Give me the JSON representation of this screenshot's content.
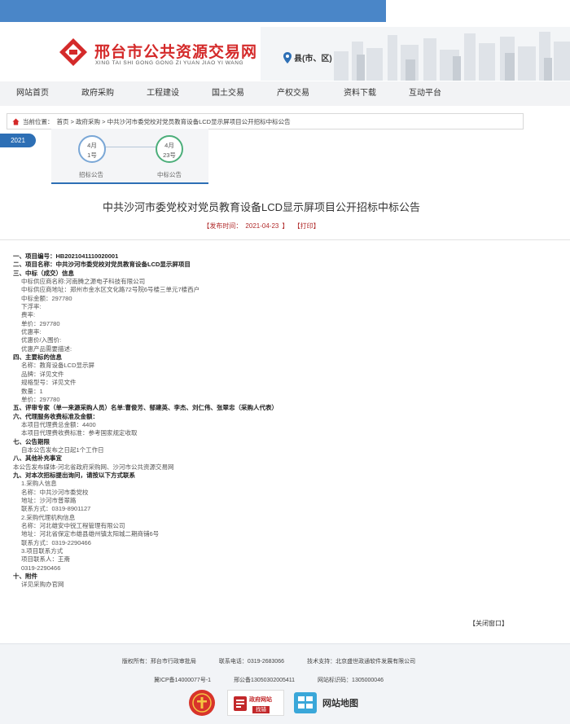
{
  "site": {
    "title": "邢台市公共资源交易网",
    "pinyin": "XING TAI SHI GONG GONG ZI YUAN JIAO YI WANG",
    "region": "县(市、区)"
  },
  "nav": [
    {
      "label": "网站首页"
    },
    {
      "label": "政府采购"
    },
    {
      "label": "工程建设"
    },
    {
      "label": "国土交易"
    },
    {
      "label": "产权交易"
    },
    {
      "label": "资料下载"
    },
    {
      "label": "互动平台"
    }
  ],
  "breadcrumb": {
    "prefix": "当前位置：",
    "path": "首页 > 政府采购 > 中共沙河市委党校对党员教育设备LCD显示屏项目公开招标中标公告"
  },
  "timeline": {
    "year": "2021",
    "nodes": [
      {
        "month": "4月",
        "day": "1号",
        "label": "招标公告"
      },
      {
        "month": "4月",
        "day": "23号",
        "label": "中标公告"
      }
    ]
  },
  "article": {
    "title": "中共沙河市委党校对党员教育设备LCD显示屏项目公开招标中标公告",
    "publish_label": "【发布时间：",
    "publish_date": "2021-04-23",
    "publish_close": "】",
    "print": "【打印】",
    "lines": [
      {
        "t": "h",
        "text": "一、项目编号：HB2021041110020001"
      },
      {
        "t": "h",
        "text": "二、项目名称：中共沙河市委党校对党员教育设备LCD显示屏项目"
      },
      {
        "t": "h",
        "text": "三、中标（成交）信息"
      },
      {
        "t": "s",
        "text": "中标供应商名称:河南腾之源电子科技有限公司"
      },
      {
        "t": "s",
        "text": "中标供应商地址：郑州市金水区文化路72号院6号楼三单元7楼西户"
      },
      {
        "t": "s",
        "text": "中标金额：297780"
      },
      {
        "t": "s",
        "text": "下浮率:"
      },
      {
        "t": "s",
        "text": "费率:"
      },
      {
        "t": "s",
        "text": "单价：297780"
      },
      {
        "t": "s",
        "text": "优惠率:"
      },
      {
        "t": "s",
        "text": "优惠价/入围价:"
      },
      {
        "t": "s",
        "text": "优惠产品需要描述:"
      },
      {
        "t": "h",
        "text": "四、主要标的信息"
      },
      {
        "t": "s",
        "text": "名称：教育设备LCD显示屏"
      },
      {
        "t": "s",
        "text": "品牌：详见文件"
      },
      {
        "t": "s",
        "text": "规格型号：详见文件"
      },
      {
        "t": "s",
        "text": "数量：1"
      },
      {
        "t": "s",
        "text": "单价：297780"
      },
      {
        "t": "h",
        "text": "五、评审专家（单一来源采购人员）名单:曹俊芳、郁建英、李杰、刘仁伟、张翠忠（采购人代表）"
      },
      {
        "t": "h",
        "text": "六、代理服务收费标准及金额："
      },
      {
        "t": "s",
        "text": "本项目代理费总金额：4400"
      },
      {
        "t": "s",
        "text": "本项目代理费收费标准：参考国家规定收取"
      },
      {
        "t": "h",
        "text": "七、公告期限"
      },
      {
        "t": "s",
        "text": "自本公告发布之日起1个工作日"
      },
      {
        "t": "h",
        "text": "八、其他补充事宜"
      },
      {
        "t": "p",
        "text": "本公告发布媒体-河北省政府采购网、沙河市公共资源交易网"
      },
      {
        "t": "h",
        "text": "九、对本次招标提出询问，请按以下方式联系"
      },
      {
        "t": "s",
        "text": "1.采购人信息"
      },
      {
        "t": "s",
        "text": "名称：中共沙河市委党校"
      },
      {
        "t": "s",
        "text": "地址：沙河市普翠路"
      },
      {
        "t": "s",
        "text": "联系方式：0319-8901127"
      },
      {
        "t": "s",
        "text": "2.采购代理机构信息"
      },
      {
        "t": "s",
        "text": "名称：河北雄安中锐工程管理有限公司"
      },
      {
        "t": "s",
        "text": "地址：河北省保定市雄县雄州镇太阳城二期商铺6号"
      },
      {
        "t": "s",
        "text": "联系方式：0319-2290466"
      },
      {
        "t": "s",
        "text": "3.项目联系方式"
      },
      {
        "t": "s",
        "text": "项目联系人：王斋"
      },
      {
        "t": "s",
        "text": "0319-2290466"
      },
      {
        "t": "h",
        "text": "十、附件"
      },
      {
        "t": "s",
        "text": "详见采购办官网"
      }
    ],
    "close_window": "【关闭窗口】"
  },
  "footer": {
    "sponsor": "版权所有：邢台市行政审批局",
    "phone": "联系电话：0319-2683066",
    "support": "技术支持：北京盛世政通软件发展有限公司",
    "icp": "冀ICP备14000077号-1",
    "police": "邢公备13050302005411",
    "site_code": "网站标识码：1305000046",
    "badge_gov": "政府网站",
    "badge_gov_sub": "找错",
    "sitemap": "网站地图"
  },
  "colors": {
    "topbar": "#4a86c8",
    "accent": "#2d6fb5",
    "brand_red": "#d42a2a"
  }
}
